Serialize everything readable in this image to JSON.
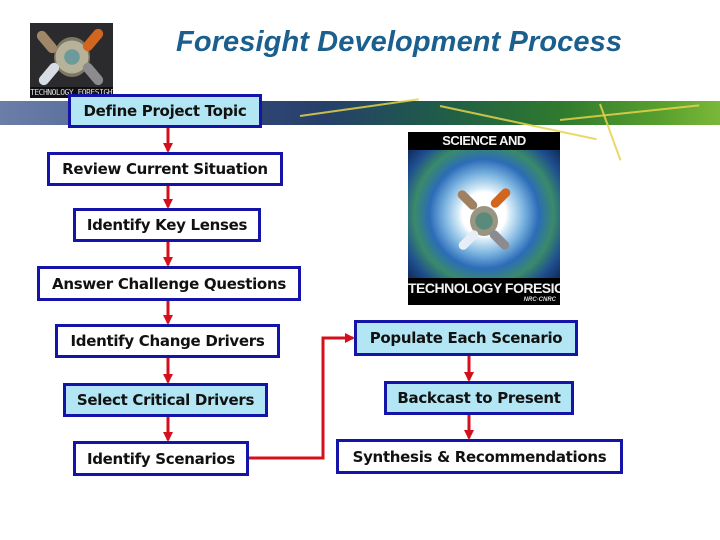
{
  "title": "Foresight Development Process",
  "logo": {
    "caption": "TECHNOLOGY FORESIGHT",
    "icon": "people-around-globe-icon"
  },
  "poster": {
    "top_text": "SCIENCE AND",
    "bottom_text": "TECHNOLOGY FORESIGHT",
    "credit": "NRC·CNRC"
  },
  "colors": {
    "title": "#1a5f8e",
    "box_border": "#1414a8",
    "highlight_fill": "#b2e6f4",
    "arrow": "#d4101c"
  },
  "left_column": [
    {
      "label": "Define Project Topic",
      "highlighted": true
    },
    {
      "label": "Review Current Situation",
      "highlighted": false
    },
    {
      "label": "Identify Key Lenses",
      "highlighted": false
    },
    {
      "label": "Answer Challenge Questions",
      "highlighted": false
    },
    {
      "label": "Identify Change Drivers",
      "highlighted": false
    },
    {
      "label": "Select Critical Drivers",
      "highlighted": true
    },
    {
      "label": "Identify Scenarios",
      "highlighted": false
    }
  ],
  "right_column": [
    {
      "label": "Populate Each Scenario",
      "highlighted": true
    },
    {
      "label": "Backcast to Present",
      "highlighted": true
    },
    {
      "label": "Synthesis & Recommendations",
      "highlighted": false
    }
  ]
}
